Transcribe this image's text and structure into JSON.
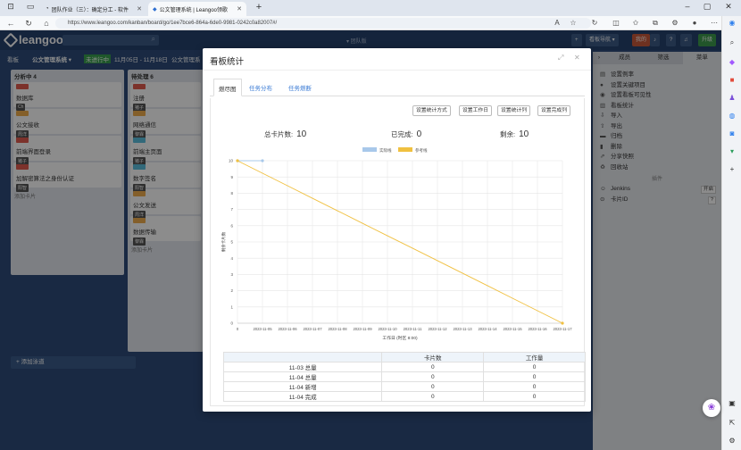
{
  "browser": {
    "tabs": [
      {
        "label": "团队作业（三）：确定分工 - 软件"
      },
      {
        "label": "公文管理系统 | Leangoo领歌"
      }
    ],
    "url": "https://www.leangoo.com/kanban/board/go/1ee7bce6-864a-6de0-9981-0242c0a82007#/",
    "read_aloud": "A"
  },
  "app": {
    "logo": "leangoo",
    "team": "▾ 团队版",
    "board_prefix": "看板",
    "board_name": "公文管理系统 ▾",
    "sprint_badge": "未进行中",
    "sprint_dates": "11月05日 - 11月18日",
    "sprint_name": "公文管理系",
    "top_buttons": [
      "看板导航 ▾",
      "我的",
      "?",
      "升级"
    ],
    "columns": [
      {
        "title": "分析中 4",
        "cards": [
          {
            "title": "数据库",
            "owner": "Ch",
            "tag": "#e25b4f"
          },
          {
            "title": "公文接收",
            "owner": "周洋",
            "tag": "#f0ad4e"
          },
          {
            "title": "前端界面登录",
            "owner": "猪子",
            "tag": "#e25b4f"
          },
          {
            "title": "加解密算法之身份认证",
            "owner": "阳智",
            "tag": "#e25b4f"
          }
        ],
        "add": "添加卡片"
      },
      {
        "title": "待处理 6",
        "cards": [
          {
            "title": "注册",
            "owner": "猪子",
            "tag": "#e25b4f"
          },
          {
            "title": "网络通信",
            "owner": "黎霖",
            "tag": "#f0ad4e"
          },
          {
            "title": "前端主页面",
            "owner": "猪子",
            "tag": "#5bc0de"
          },
          {
            "title": "数字签名",
            "owner": "阳智",
            "tag": "#5bc0de"
          },
          {
            "title": "公文发送",
            "owner": "周洋",
            "tag": "#f0ad4e"
          },
          {
            "title": "数据传输",
            "owner": "黎霖",
            "tag": "#f0ad4e"
          }
        ],
        "add": "添加卡片"
      }
    ],
    "add_list": "+ 添加泳道"
  },
  "right_panel": {
    "tabs": [
      "成员",
      "筛选",
      "菜单"
    ],
    "menu": [
      "设置例率",
      "设置关键项目",
      "设置看板可见性",
      "看板统计",
      "导入",
      "导出",
      "归档",
      "删除",
      "分享快照",
      "回收站"
    ],
    "section": "插件",
    "plugins": [
      {
        "label": "Jenkins",
        "badge": "开启"
      },
      {
        "label": "卡片ID",
        "badge": "?"
      }
    ]
  },
  "modal": {
    "title": "看板统计",
    "tabs": [
      "燃尽图",
      "任务分布",
      "任务燃断"
    ],
    "buttons": [
      "设置统计方式",
      "设置工作日",
      "设置统计列",
      "设置完成列"
    ],
    "stats": [
      {
        "label": "总卡片数:",
        "value": "10"
      },
      {
        "label": "已完成:",
        "value": "0"
      },
      {
        "label": "剩余:",
        "value": "10"
      }
    ],
    "table": {
      "headers": [
        "",
        "卡片数",
        "工作量"
      ],
      "rows": [
        [
          "11-03 总量",
          "0",
          "0"
        ],
        [
          "11-04 总量",
          "0",
          "0"
        ],
        [
          "11-04 新增",
          "0",
          "0"
        ],
        [
          "11-04 完成",
          "0",
          "0"
        ]
      ]
    }
  },
  "chart_data": {
    "type": "line",
    "x": [
      "0",
      "2023-11-05",
      "2023-11-06",
      "2023-11-07",
      "2023-11-08",
      "2023-11-09",
      "2023-11-10",
      "2023-11-11",
      "2023-11-12",
      "2023-11-13",
      "2023-11-14",
      "2023-11-15",
      "2023-11-16",
      "2023-11-17"
    ],
    "series": [
      {
        "name": "实际线",
        "values": [
          10,
          10,
          null,
          null,
          null,
          null,
          null,
          null,
          null,
          null,
          null,
          null,
          null,
          null
        ],
        "color": "#a8c8ea"
      },
      {
        "name": "参考线",
        "values": [
          10,
          9.23,
          8.46,
          7.69,
          6.92,
          6.15,
          5.38,
          4.62,
          3.85,
          3.08,
          2.31,
          1.54,
          0.77,
          0
        ],
        "color": "#f0c040"
      }
    ],
    "ylim": [
      0,
      10
    ],
    "yticks": [
      0,
      1,
      2,
      3,
      4,
      5,
      6,
      7,
      8,
      9,
      10
    ],
    "ylabel": "剩余卡片数",
    "xlabel": "工作日 (时区 8:00)",
    "legend": "top-center",
    "grid": true
  }
}
